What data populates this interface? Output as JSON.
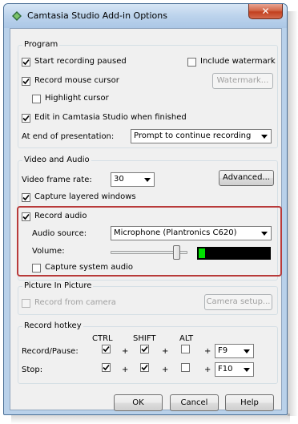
{
  "window": {
    "title": "Camtasia Studio Add-in Options",
    "close_glyph": "✕"
  },
  "program": {
    "legend": "Program",
    "start_recording_paused": {
      "label": "Start recording paused",
      "checked": true
    },
    "include_watermark": {
      "label": "Include watermark",
      "checked": false
    },
    "record_mouse_cursor": {
      "label": "Record mouse cursor",
      "checked": true
    },
    "watermark_button": "Watermark...",
    "highlight_cursor": {
      "label": "Highlight cursor",
      "checked": false
    },
    "edit_when_finished": {
      "label": "Edit in Camtasia Studio when finished",
      "checked": true
    },
    "end_of_presentation_label": "At end of presentation:",
    "end_of_presentation_value": "Prompt to continue recording"
  },
  "video_audio": {
    "legend": "Video and Audio",
    "frame_rate_label": "Video frame rate:",
    "frame_rate_value": "30",
    "advanced_button": "Advanced...",
    "capture_layered_windows": {
      "label": "Capture layered windows",
      "checked": true
    },
    "record_audio": {
      "label": "Record audio",
      "checked": true
    },
    "audio_source_label": "Audio source:",
    "audio_source_value": "Microphone (Plantronics C620)",
    "volume_label": "Volume:",
    "volume_level": 0.9,
    "audio_meter_level": 0.08,
    "capture_system_audio": {
      "label": "Capture system audio",
      "checked": false
    }
  },
  "pip": {
    "legend": "Picture In Picture",
    "record_from_camera": {
      "label": "Record from camera",
      "checked": false
    },
    "camera_setup_button": "Camera setup..."
  },
  "hotkey": {
    "legend": "Record hotkey",
    "col_ctrl": "CTRL",
    "col_shift": "SHIFT",
    "col_alt": "ALT",
    "plus": "+",
    "rows": [
      {
        "label": "Record/Pause:",
        "ctrl": true,
        "shift": true,
        "alt": false,
        "key": "F9"
      },
      {
        "label": "Stop:",
        "ctrl": true,
        "shift": true,
        "alt": false,
        "key": "F10"
      }
    ]
  },
  "buttons": {
    "ok": "OK",
    "cancel": "Cancel",
    "help": "Help"
  },
  "colors": {
    "highlight_box": "#b83a3a",
    "meter_fill": "#00e000"
  }
}
